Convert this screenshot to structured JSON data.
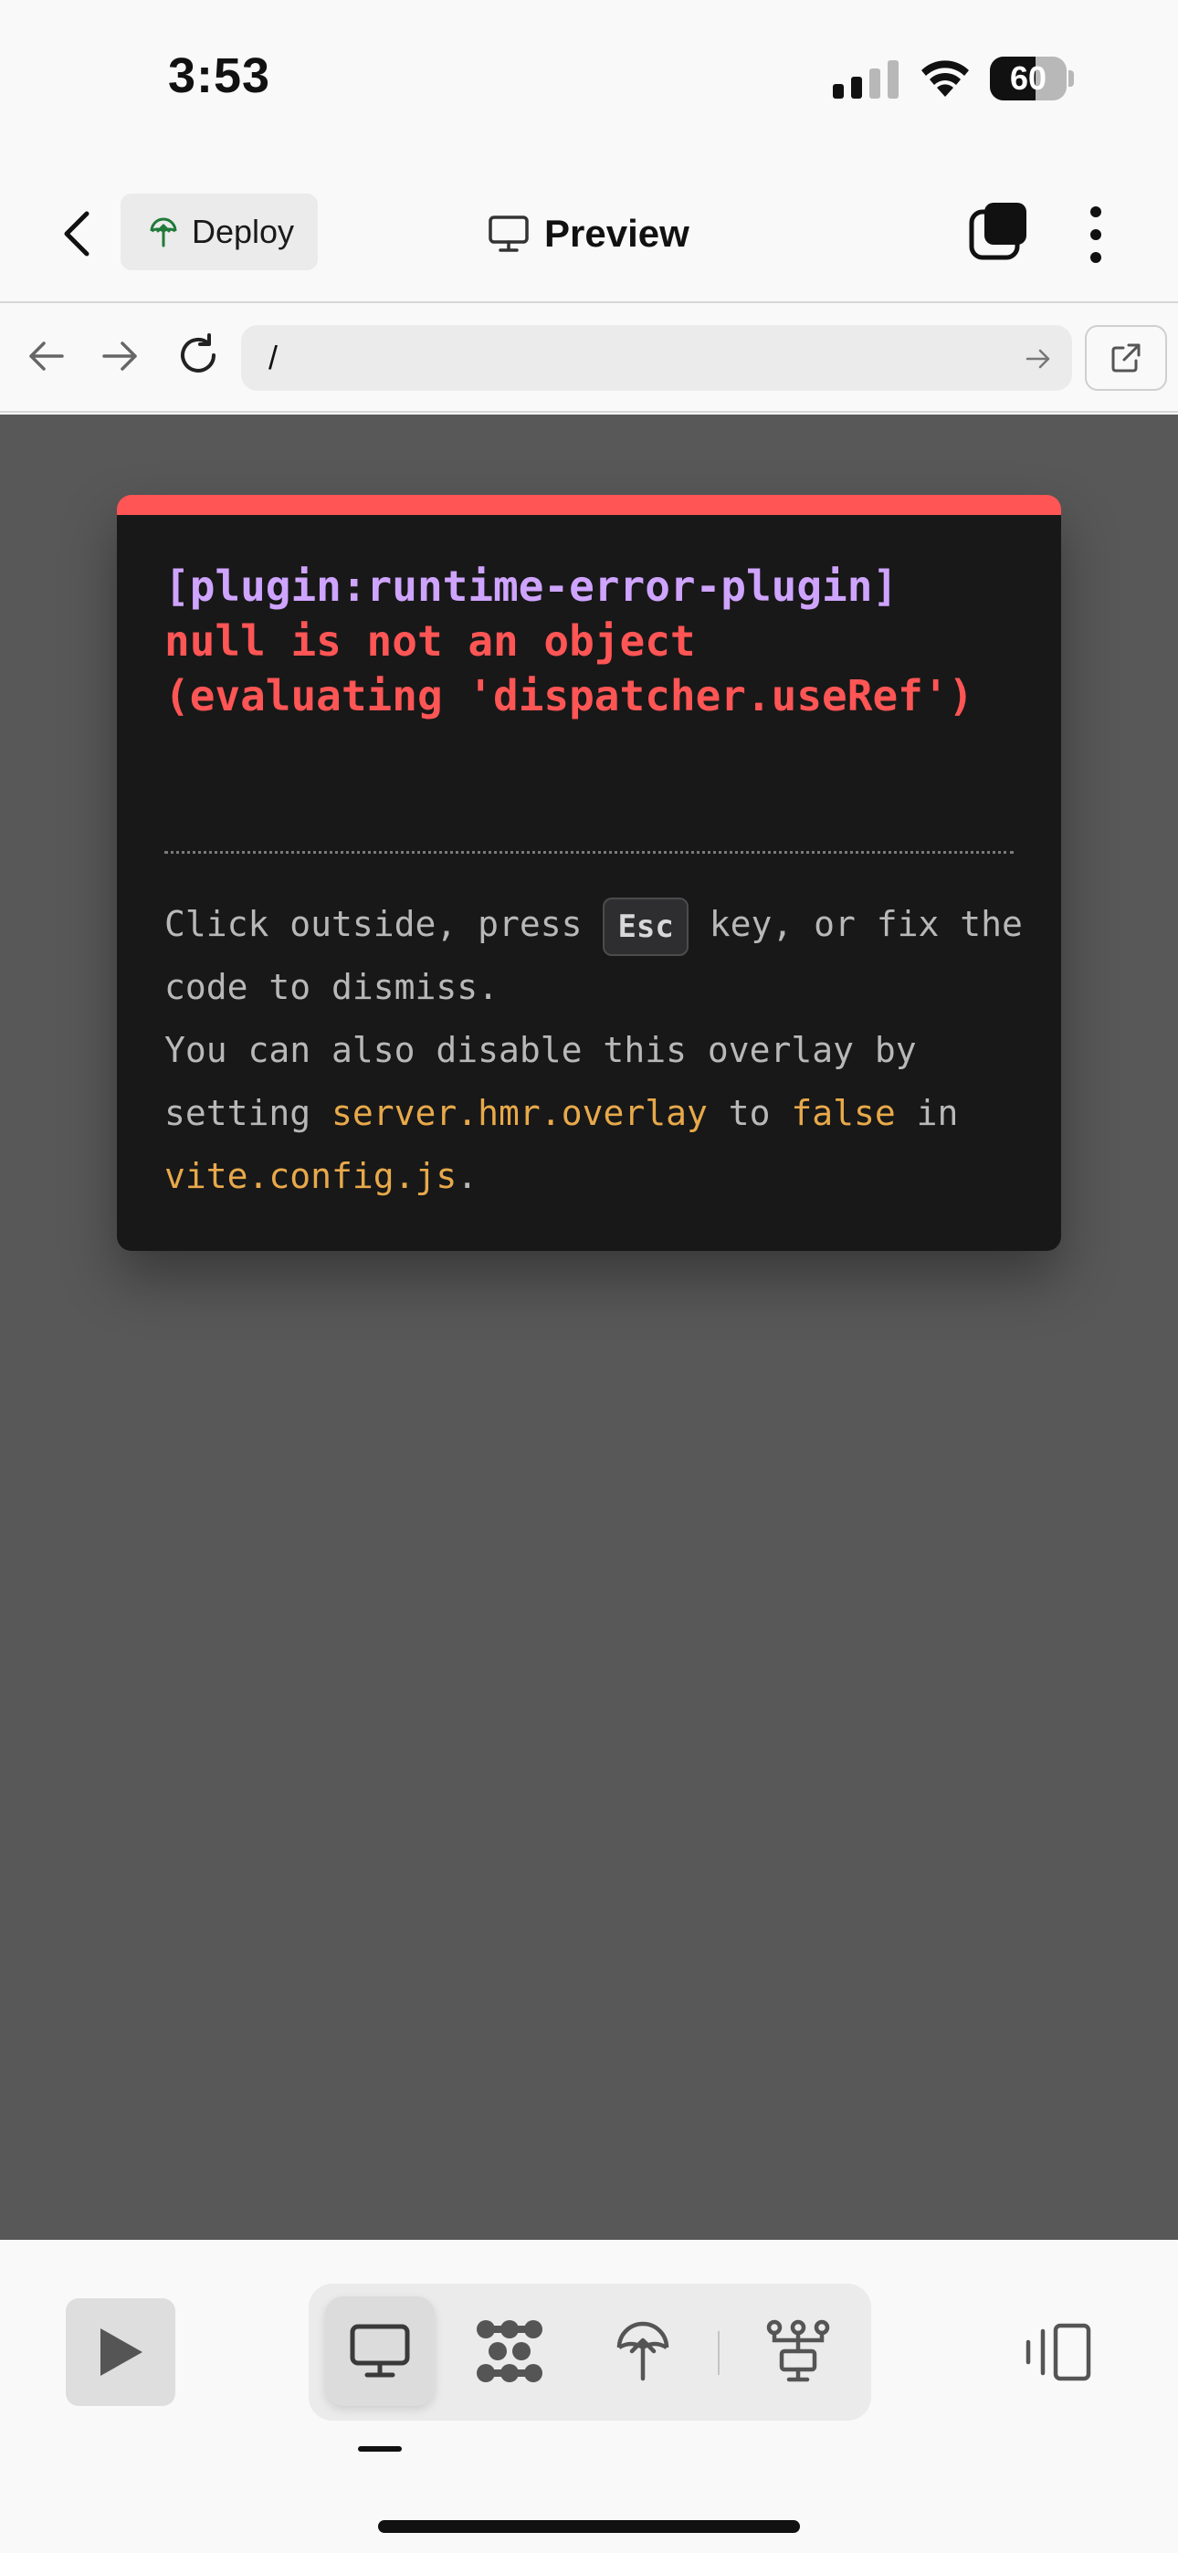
{
  "status_bar": {
    "time": "3:53",
    "battery_level": "60",
    "battery_fraction": 0.6,
    "signal_bars_active": 2,
    "signal_bars_total": 4
  },
  "header": {
    "back_icon": "chevron-left-icon",
    "deploy_label": "Deploy",
    "deploy_icon": "globe-upload-icon",
    "title": "Preview",
    "title_icon": "monitor-icon",
    "tabs_icon": "stacked-squares-icon",
    "more_icon": "vertical-dots-icon"
  },
  "url_bar": {
    "url": "/",
    "back_icon": "arrow-left-icon",
    "forward_icon": "arrow-right-icon",
    "reload_icon": "reload-icon",
    "go_icon": "arrow-right-icon",
    "open_external_icon": "external-link-icon"
  },
  "error_overlay": {
    "plugin": "[plugin:runtime-error-plugin]",
    "message": "null is not an object\n(evaluating 'dispatcher.useRef')",
    "tip": {
      "part1": "Click outside, press ",
      "key": "Esc",
      "part2": " key, or fix the code to dismiss.",
      "part3": "You can also disable this overlay by setting ",
      "setting": "server.hmr.overlay",
      "part4": " to ",
      "value": "false",
      "part5": " in ",
      "file": "vite.config.js",
      "part6": "."
    }
  },
  "bottom_toolbar": {
    "run_icon": "play-icon",
    "modes": [
      {
        "icon": "monitor-icon",
        "active": true
      },
      {
        "icon": "dots-grid-icon",
        "active": false
      },
      {
        "icon": "globe-upload-icon",
        "active": false
      },
      {
        "icon": "network-tree-icon",
        "active": false
      }
    ],
    "panel_icon": "side-panel-icon"
  },
  "colors": {
    "error_accent": "#ff5555",
    "plugin_text": "#cfa4ff",
    "code_highlight": "#e8a94a",
    "overlay_bg": "#181818",
    "preview_bg": "#585858"
  }
}
